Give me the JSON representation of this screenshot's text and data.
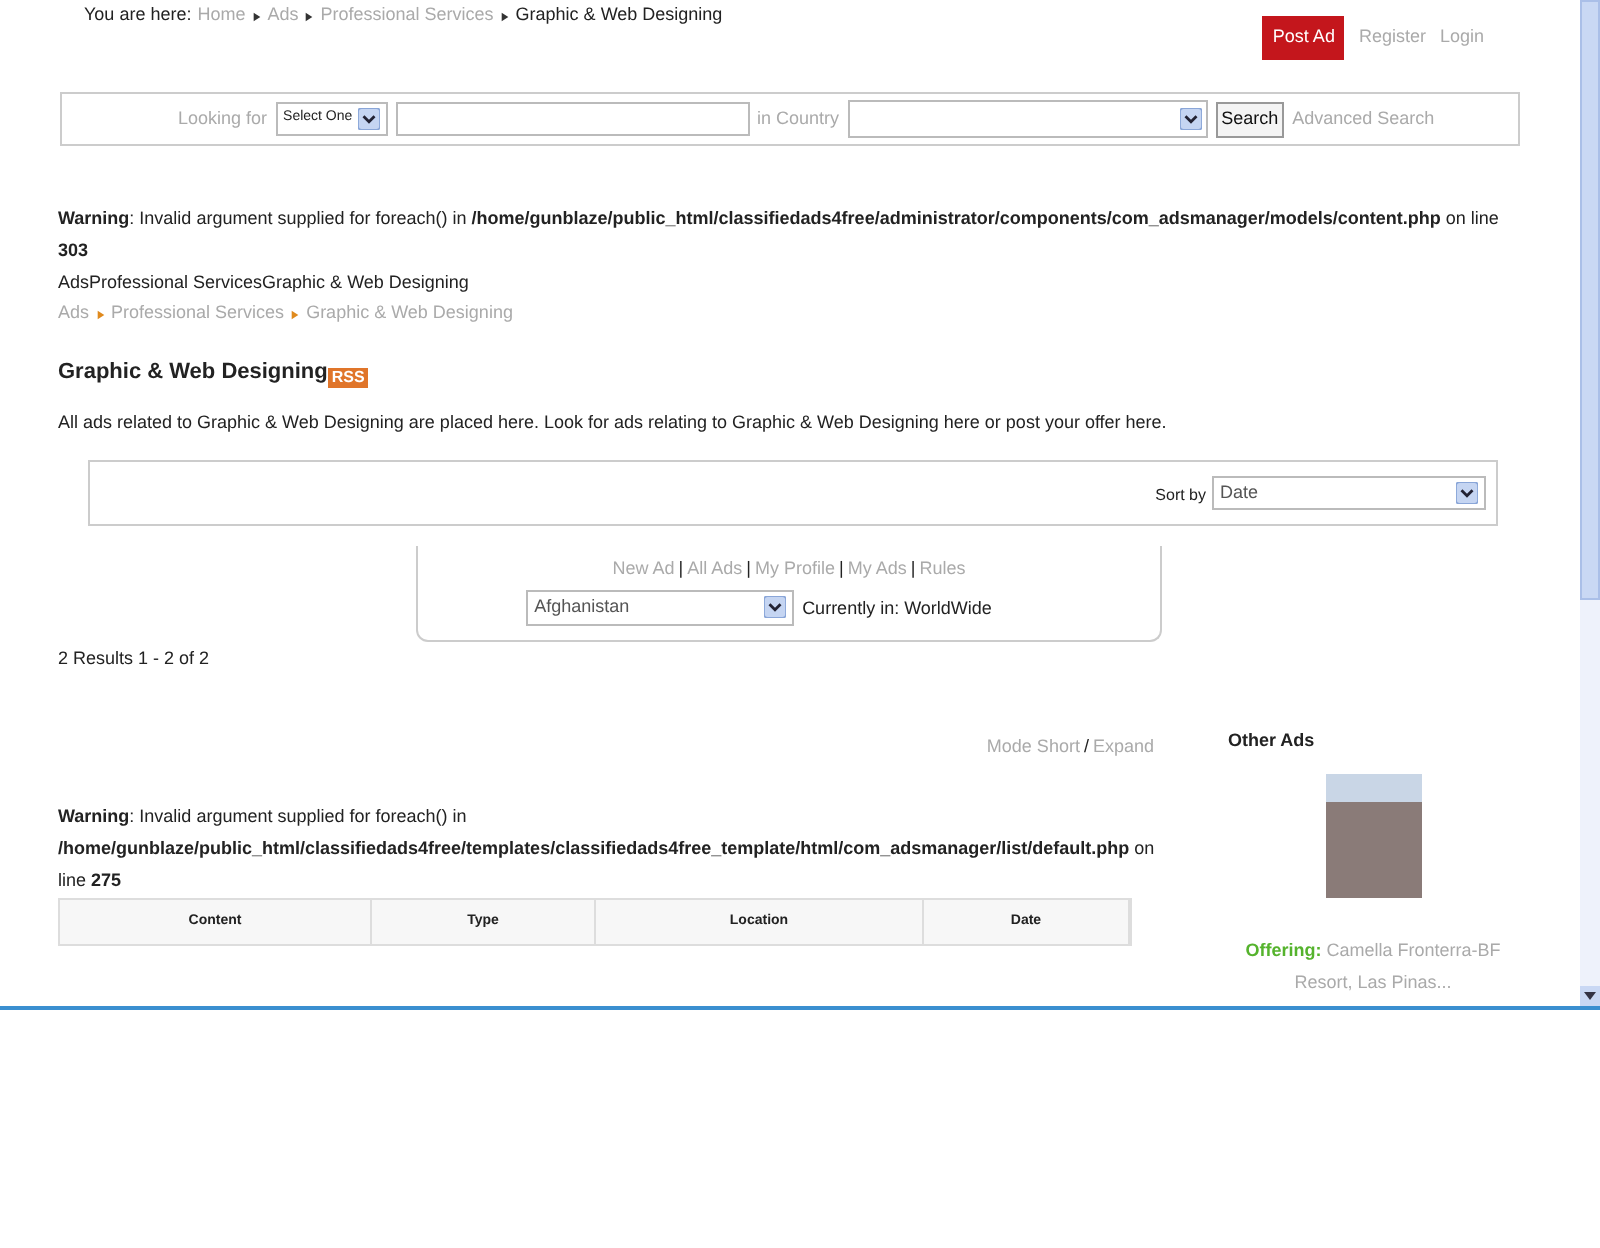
{
  "breadcrumb": {
    "label": "You are here:",
    "items": [
      {
        "text": "Home",
        "current": false
      },
      {
        "text": "Ads",
        "current": false
      },
      {
        "text": "Professional Services",
        "current": false
      },
      {
        "text": "Graphic & Web Designing",
        "current": true
      }
    ]
  },
  "header_links": {
    "post_ad": "Post Ad",
    "register": "Register",
    "login": "Login"
  },
  "search": {
    "looking_for_label": "Looking for",
    "category_select": "Select One",
    "country_label": "in Country",
    "search_button": "Search",
    "advanced_search": "Advanced Search"
  },
  "warning_top": "**Warning**: Invalid argument supplied for foreach() in **/home/gunblaze/public_html/classifiedads4free/administrator/components/com_adsmanager/models/content.php** on line **303**",
  "plain_path": "AdsProfessional ServicesGraphic & Web Designing",
  "category_breadcrumb": [
    "Ads",
    "Professional Services",
    "Graphic & Web Designing"
  ],
  "category": {
    "title": "Graphic & Web Designing",
    "rss_badge": "RSS",
    "description": "All ads related to Graphic & Web Designing are placed here. Look for ads relating to Graphic & Web Designing here or post your offer here."
  },
  "sort": {
    "label": "Sort by",
    "value": "Date"
  },
  "user_menu": {
    "links": [
      "New Ad",
      "All Ads",
      "My Profile",
      "My Ads",
      "Rules"
    ],
    "separator": "|",
    "country_select": "Afghanistan",
    "current_location": "Currently in: WorldWide"
  },
  "results_count": "2 Results 1 - 2 of 2",
  "view_modes": {
    "short": "Mode Short",
    "separator": "/",
    "expand": "Expand"
  },
  "warning_list": "**Warning**: Invalid argument supplied for foreach() in **/home/gunblaze/public_html/classifiedads4free/templates/classifiedads4free_template/html/com_adsmanager/list/default.php** on line **275**",
  "table": {
    "columns": [
      "Content",
      "Type",
      "Location",
      "Date"
    ]
  },
  "other_ads": {
    "title": "Other Ads",
    "ads": [
      {
        "label": "Offering:",
        "text": "Camella Fronterra-BF Resort, Las Pinas..."
      }
    ]
  }
}
